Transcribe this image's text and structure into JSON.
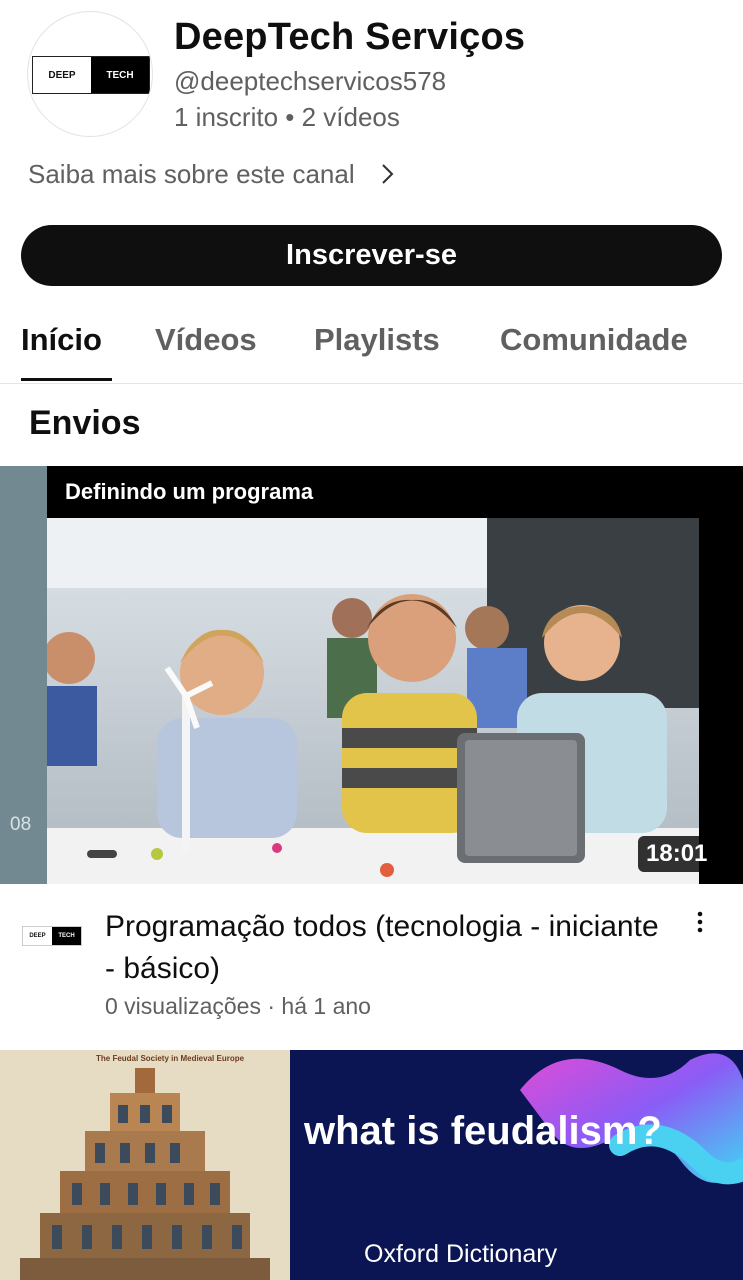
{
  "channel": {
    "logo_left": "DEEP",
    "logo_right": "TECH",
    "name": "DeepTech Serviços",
    "handle": "@deeptechservicos578",
    "stats": "1 inscrito • 2 vídeos",
    "about_link": "Saiba mais sobre este canal",
    "subscribe_label": "Inscrever-se"
  },
  "tabs": [
    {
      "label": "Início",
      "active": true
    },
    {
      "label": "Vídeos",
      "active": false
    },
    {
      "label": "Playlists",
      "active": false
    },
    {
      "label": "Comunidade",
      "active": false
    }
  ],
  "section": {
    "title": "Envios"
  },
  "videos": [
    {
      "thumbnail_title": "Definindo um programa",
      "thumbnail_side_number": "08",
      "duration": "18:01",
      "title": "Programação todos (tecnologia - iniciante - básico)",
      "meta": "0 visualizações · há 1 ano"
    },
    {
      "thumbnail_chart_title": "The Feudal Society in Medieval Europe",
      "thumbnail_question": "what is feudalism?",
      "thumbnail_brand": "Oxford Dictionary"
    }
  ],
  "colors": {
    "text_primary": "#0f0f0f",
    "text_secondary": "#606060",
    "subscribe_bg": "#0f0f0f",
    "thumb2_bg": "#0c1553"
  },
  "icons": [
    "chevron-right-icon",
    "more-vert-icon"
  ]
}
